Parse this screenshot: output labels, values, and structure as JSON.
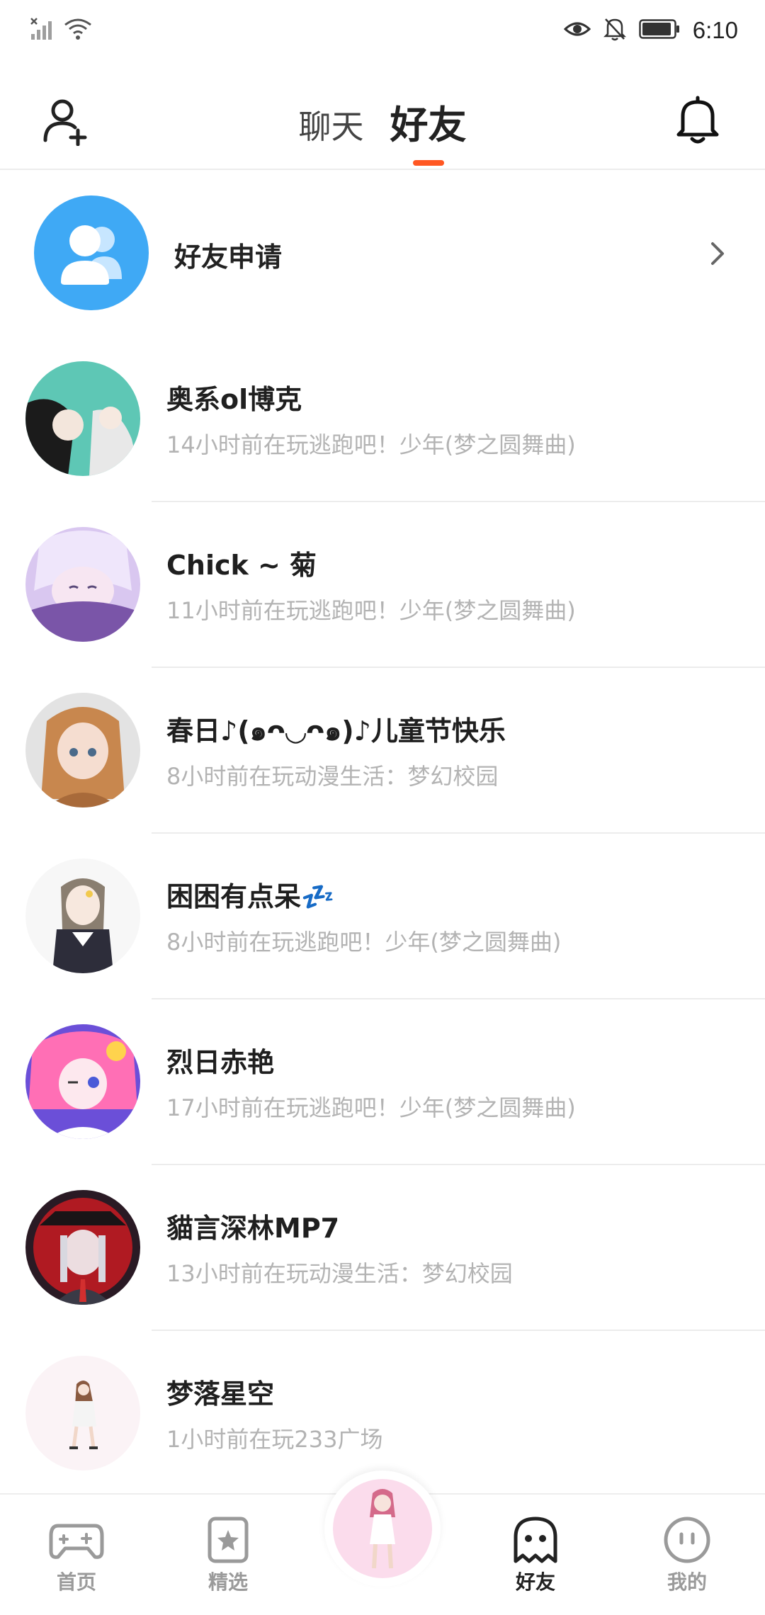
{
  "status_bar": {
    "time": "6:10",
    "icons": [
      "no-sim-signal-icon",
      "wifi-icon",
      "eye-icon",
      "bell-off-icon",
      "battery-icon"
    ]
  },
  "header": {
    "tabs": [
      {
        "label": "聊天",
        "active": false
      },
      {
        "label": "好友",
        "active": true
      }
    ],
    "accent_color": "#ff5722",
    "left_icon": "add-friend-icon",
    "right_icon": "bell-icon"
  },
  "friend_request": {
    "label": "好友申请",
    "icon": "friends-group-icon",
    "icon_bg": "#3fa9f5"
  },
  "friends": [
    {
      "name": "奥系ol博克",
      "status": "14小时前在玩逃跑吧！少年(梦之圆舞曲)",
      "avatar_colors": [
        "#5ec7b5",
        "#1b1b1b"
      ]
    },
    {
      "name": "Chick ~ 菊",
      "status": "11小时前在玩逃跑吧！少年(梦之圆舞曲)",
      "avatar_colors": [
        "#d9c7f0",
        "#7a55a8"
      ]
    },
    {
      "name": "春日♪(๑ᴖ◡ᴖ๑)♪儿童节快乐",
      "status": "8小时前在玩动漫生活：梦幻校园",
      "avatar_colors": [
        "#e3e3e3",
        "#c8874e"
      ]
    },
    {
      "name": "困困有点呆💤",
      "status": "8小时前在玩逃跑吧！少年(梦之圆舞曲)",
      "avatar_colors": [
        "#f4f4f4",
        "#6b6b6b"
      ]
    },
    {
      "name": "烈日赤艳",
      "status": "17小时前在玩逃跑吧！少年(梦之圆舞曲)",
      "avatar_colors": [
        "#ff6fb5",
        "#6b4fd8"
      ]
    },
    {
      "name": "貓言深林MP7",
      "status": "13小时前在玩动漫生活：梦幻校园",
      "avatar_colors": [
        "#2a1a24",
        "#b01a22"
      ]
    },
    {
      "name": "梦落星空",
      "status": "1小时前在玩233广场",
      "avatar_colors": [
        "#fbf3f6",
        "#c9a08a"
      ]
    }
  ],
  "bottom_nav": [
    {
      "label": "首页",
      "icon": "gamepad-icon",
      "active": false
    },
    {
      "label": "精选",
      "icon": "star-card-icon",
      "active": false
    },
    {
      "label": "",
      "icon": "center-avatar",
      "active": false
    },
    {
      "label": "好友",
      "icon": "ghost-icon",
      "active": true
    },
    {
      "label": "我的",
      "icon": "face-icon",
      "active": false
    }
  ]
}
